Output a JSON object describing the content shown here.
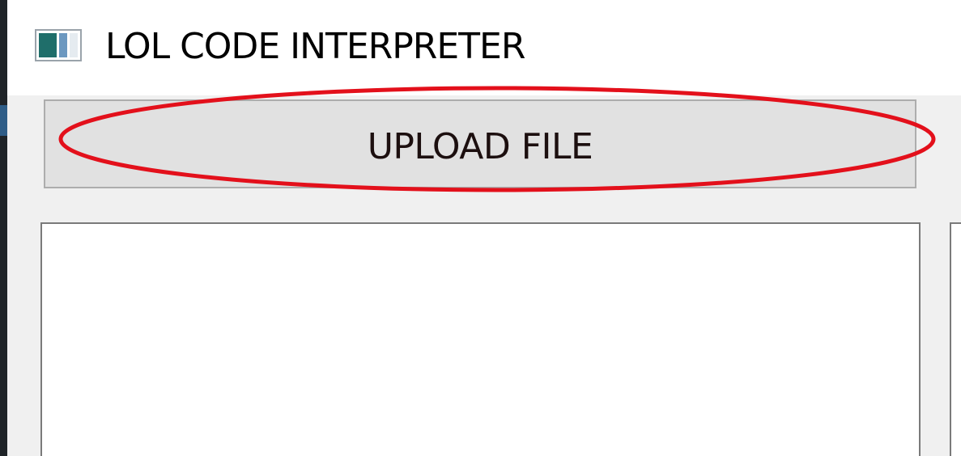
{
  "window": {
    "title": "LOL CODE INTERPRETER",
    "icon": "app-window-icon"
  },
  "toolbar": {
    "upload_label": "UPLOAD FILE"
  },
  "editor": {
    "code_value": ""
  },
  "annotation": {
    "color": "#e3101b"
  }
}
